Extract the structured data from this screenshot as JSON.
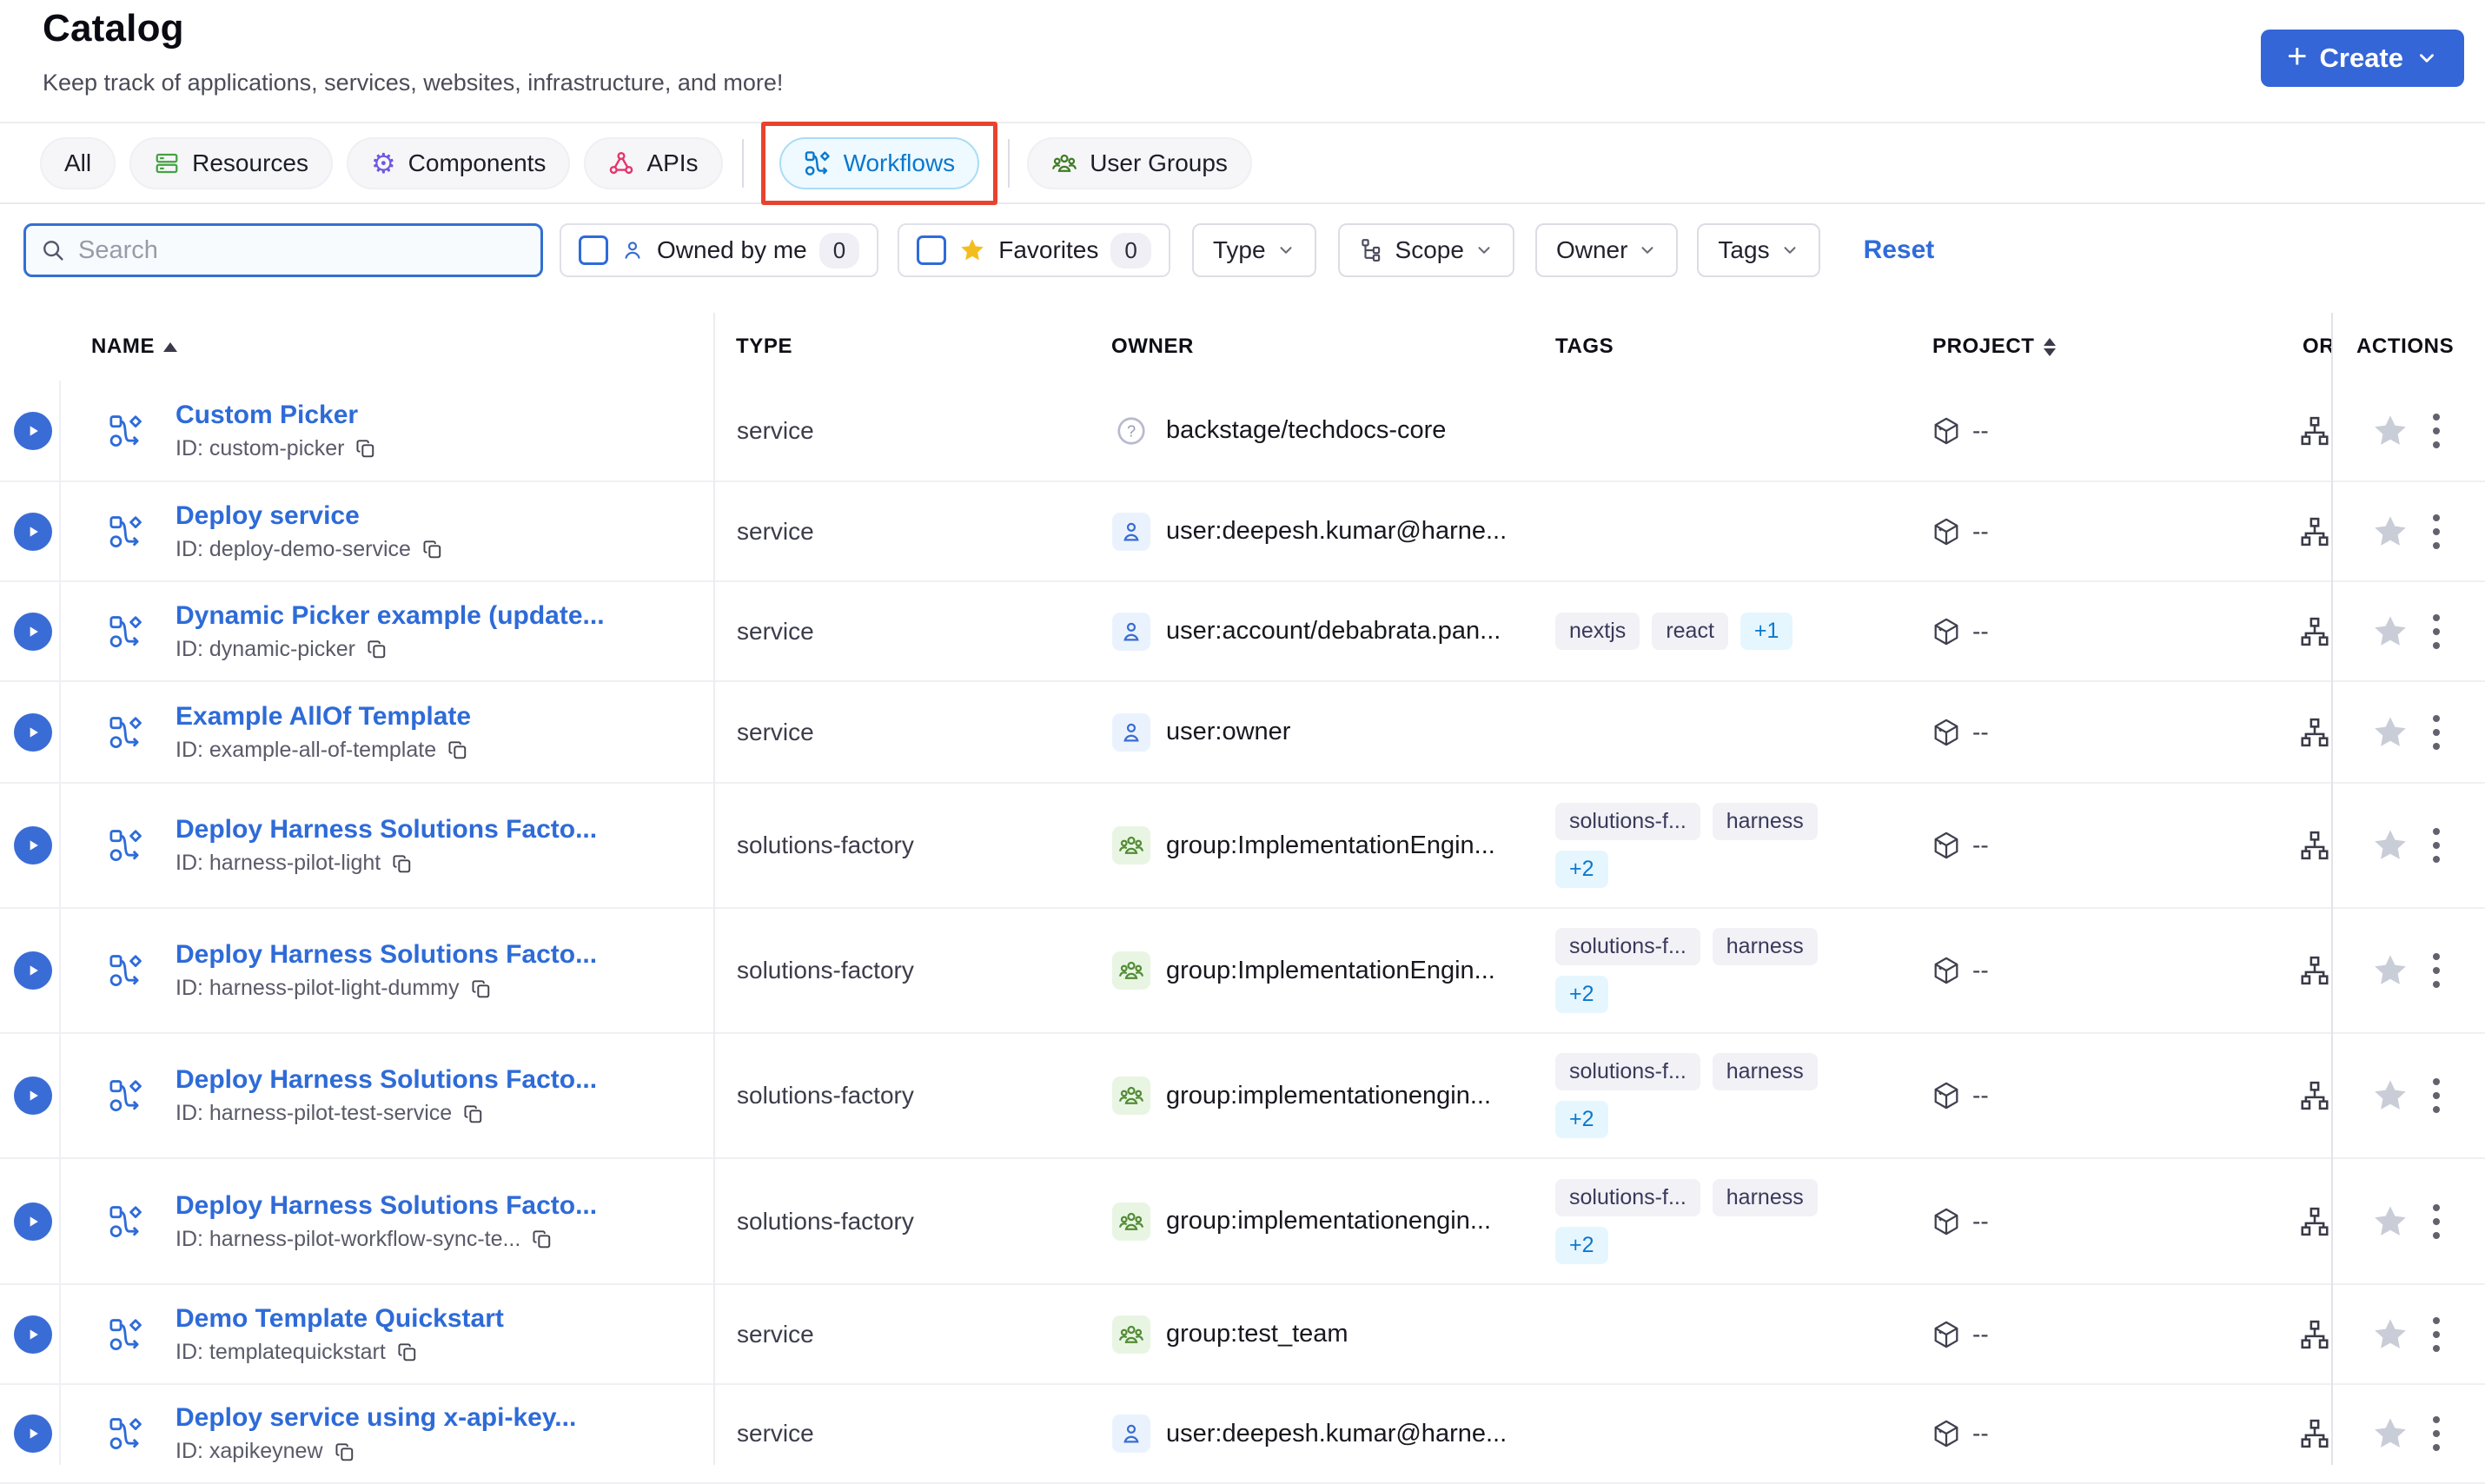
{
  "page": {
    "title": "Catalog",
    "subtitle": "Keep track of applications, services, websites, infrastructure, and more!"
  },
  "create_button": {
    "label": "Create"
  },
  "tabs": [
    {
      "label": "All",
      "icon": "none",
      "active": false
    },
    {
      "label": "Resources",
      "icon": "layers-icon",
      "active": false
    },
    {
      "label": "Components",
      "icon": "gear-icon",
      "active": false
    },
    {
      "label": "APIs",
      "icon": "api-icon",
      "active": false
    },
    {
      "label": "Workflows",
      "icon": "workflow-icon",
      "active": true,
      "highlighted": "red-box"
    },
    {
      "label": "User Groups",
      "icon": "users-icon",
      "active": false
    }
  ],
  "filters": {
    "search_placeholder": "Search",
    "owned_by_me": {
      "label": "Owned by me",
      "count": "0",
      "checked": false
    },
    "favorites": {
      "label": "Favorites",
      "count": "0",
      "checked": false
    },
    "type_label": "Type",
    "scope_label": "Scope",
    "owner_label": "Owner",
    "tags_label": "Tags",
    "reset_label": "Reset"
  },
  "table": {
    "headers": {
      "name": "NAME",
      "type": "TYPE",
      "owner": "OWNER",
      "tags": "TAGS",
      "project": "PROJECT",
      "org_truncated": "OR",
      "actions": "ACTIONS"
    },
    "rows": [
      {
        "name": "Custom Picker",
        "entity_id": "ID: custom-picker",
        "type": "service",
        "owner": {
          "kind": "unknown",
          "label": "backstage/techdocs-core"
        },
        "tags": [],
        "more": "",
        "tags_stacked": false,
        "project": "--"
      },
      {
        "name": "Deploy service",
        "entity_id": "ID: deploy-demo-service",
        "type": "service",
        "owner": {
          "kind": "user",
          "label": "user:deepesh.kumar@harne..."
        },
        "tags": [],
        "more": "",
        "tags_stacked": false,
        "project": "--"
      },
      {
        "name": "Dynamic Picker example (update...",
        "entity_id": "ID: dynamic-picker",
        "type": "service",
        "owner": {
          "kind": "user",
          "label": "user:account/debabrata.pan..."
        },
        "tags": [
          "nextjs",
          "react"
        ],
        "more": "+1",
        "tags_stacked": false,
        "project": "--"
      },
      {
        "name": "Example AllOf Template",
        "entity_id": "ID: example-all-of-template",
        "type": "service",
        "owner": {
          "kind": "user",
          "label": "user:owner"
        },
        "tags": [],
        "more": "",
        "tags_stacked": false,
        "project": "--"
      },
      {
        "name": "Deploy Harness Solutions Facto...",
        "entity_id": "ID: harness-pilot-light",
        "type": "solutions-factory",
        "owner": {
          "kind": "group",
          "label": "group:ImplementationEngin..."
        },
        "tags": [
          "solutions-f...",
          "harness"
        ],
        "more": "+2",
        "tags_stacked": true,
        "project": "--"
      },
      {
        "name": "Deploy Harness Solutions Facto...",
        "entity_id": "ID: harness-pilot-light-dummy",
        "type": "solutions-factory",
        "owner": {
          "kind": "group",
          "label": "group:ImplementationEngin..."
        },
        "tags": [
          "solutions-f...",
          "harness"
        ],
        "more": "+2",
        "tags_stacked": true,
        "project": "--"
      },
      {
        "name": "Deploy Harness Solutions Facto...",
        "entity_id": "ID: harness-pilot-test-service",
        "type": "solutions-factory",
        "owner": {
          "kind": "group",
          "label": "group:implementationengin..."
        },
        "tags": [
          "solutions-f...",
          "harness"
        ],
        "more": "+2",
        "tags_stacked": true,
        "project": "--"
      },
      {
        "name": "Deploy Harness Solutions Facto...",
        "entity_id": "ID: harness-pilot-workflow-sync-te...",
        "type": "solutions-factory",
        "owner": {
          "kind": "group",
          "label": "group:implementationengin..."
        },
        "tags": [
          "solutions-f...",
          "harness"
        ],
        "more": "+2",
        "tags_stacked": true,
        "project": "--"
      },
      {
        "name": "Demo Template Quickstart",
        "entity_id": "ID: templatequickstart",
        "type": "service",
        "owner": {
          "kind": "group",
          "label": "group:test_team"
        },
        "tags": [],
        "more": "",
        "tags_stacked": false,
        "project": "--"
      },
      {
        "name": "Deploy service using x-api-key...",
        "entity_id": "ID: xapikeynew",
        "type": "service",
        "owner": {
          "kind": "user",
          "label": "user:deepesh.kumar@harne..."
        },
        "tags": [],
        "more": "",
        "tags_stacked": false,
        "project": "--"
      }
    ]
  },
  "icons": [
    "plus-icon",
    "chevron-down-icon",
    "search-icon",
    "user-icon",
    "star-icon",
    "layers-icon",
    "gear-icon",
    "api-icon",
    "workflow-icon",
    "users-icon",
    "hierarchy-icon",
    "play-icon",
    "copy-icon",
    "question-icon",
    "group-icon",
    "cube-icon",
    "org-chart-icon",
    "kebab-icon",
    "sort-asc-icon",
    "sort-icon"
  ],
  "colors": {
    "primary_blue": "#2f6bd9",
    "create_button_blue": "#3566d7",
    "highlight_red": "#e8432f",
    "active_tab_bg": "#eefaff",
    "active_tab_border": "#abdcf5",
    "active_tab_text": "#0b78cd",
    "star_yellow": "#f4bd1f",
    "tag_bg": "#f1f1f6",
    "tag_more_bg": "#e6f6fe",
    "tag_more_text": "#0b78cd",
    "resources_green": "#42a33e",
    "components_purple": "#6e5ae0",
    "apis_pink": "#e5356b",
    "groups_green": "#4c7d2c"
  }
}
